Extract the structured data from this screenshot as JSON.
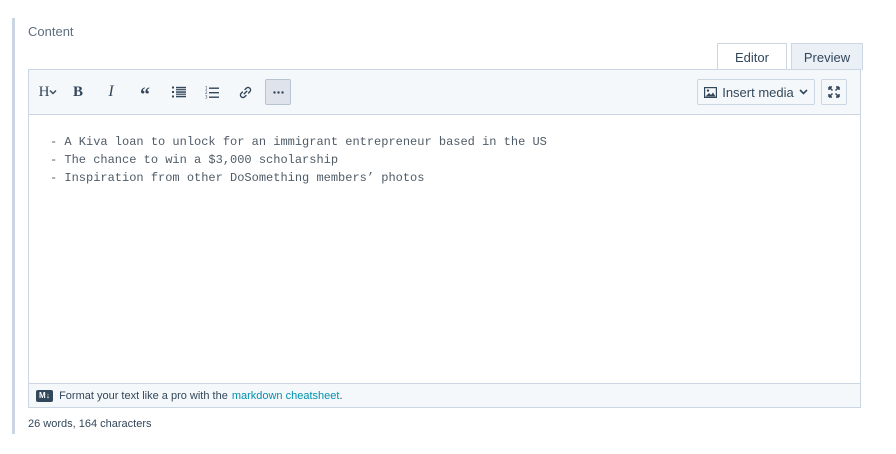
{
  "field": {
    "label": "Content"
  },
  "tabs": [
    {
      "label": "Editor"
    },
    {
      "label": "Preview"
    }
  ],
  "toolbar": {
    "heading_label": "H",
    "bold_label": "B",
    "italic_label": "I",
    "quote_label": "“",
    "insert_media_label": "Insert media",
    "icons": [
      "heading-icon",
      "bold-icon",
      "italic-icon",
      "quote-icon",
      "unordered-list-icon",
      "ordered-list-icon",
      "link-icon",
      "more-icon",
      "image-icon",
      "chevron-down-icon",
      "fullscreen-icon"
    ]
  },
  "editor": {
    "lines": [
      "- A Kiva loan to unlock for an immigrant entrepreneur based in the US",
      "- The chance to win a $3,000 scholarship",
      "- Inspiration from other DoSomething members’ photos"
    ]
  },
  "footer": {
    "badge": "M↓",
    "text": "Format your text like a pro with the",
    "link": "markdown cheatsheet",
    "suffix": "."
  },
  "counter": {
    "text": "26 words, 164 characters"
  }
}
